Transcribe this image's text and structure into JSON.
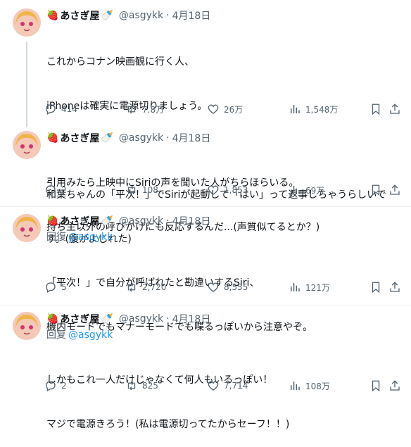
{
  "colors": {
    "text": "#0f1419",
    "muted": "#536471",
    "link": "#1d9bf0",
    "divider": "#eff3f4",
    "thread_line": "#cfd9de"
  },
  "tweets": [
    {
      "name": "あさぎ屋",
      "handle": "@asgykk",
      "separator": "·",
      "date": "4月18日",
      "reply_to_label": "",
      "reply_to_handle": "",
      "lines": [
        "これからコナン映画観に行く人、",
        "iPhoneは確実に電源切りましょう。",
        "",
        "和葉ちゃんの「平次！」でSiriが起動して「はい」って返事しちゃうらしいで",
        "す。(腹がよじれた)"
      ],
      "stats": {
        "replies": "414",
        "retweets": "7.8万",
        "likes": "26万",
        "views": "1,548万"
      }
    },
    {
      "name": "あさぎ屋",
      "handle": "@asgykk",
      "separator": "·",
      "date": "4月18日",
      "reply_to_label": "",
      "reply_to_handle": "",
      "lines": [
        "引用みたら上映中にSiriの声を聞いた人がちらほらいる。",
        "持ち主以外の呼びかけにも反応するんだ...(声質似てるとか？)"
      ],
      "stats": {
        "replies": "2",
        "retweets": "108",
        "likes": "1,853",
        "views": "69万"
      }
    },
    {
      "name": "あさぎ屋",
      "handle": "@asgykk",
      "separator": "·",
      "date": "4月18日",
      "reply_to_label": "回復",
      "reply_to_handle": "@asgykk",
      "lines": [
        "「平次！」で自分が呼ばれたと勘違いするSiri、",
        "機内モードでもマナーモードでも喋るっぽいから注意やぞ。"
      ],
      "stats": {
        "replies": "5",
        "retweets": "2,720",
        "likes": "8,555",
        "views": "121万"
      }
    },
    {
      "name": "あさぎ屋",
      "handle": "@asgykk",
      "separator": "·",
      "date": "4月18日",
      "reply_to_label": "回复",
      "reply_to_handle": "@asgykk",
      "lines": [
        "しかもこれ一人だけじゃなくて何人もいるっぽい！",
        "マジで電源きろう！(私は電源切ってたからセーフ！！)"
      ],
      "stats": {
        "replies": "2",
        "retweets": "825",
        "likes": "7,714",
        "views": "108万"
      }
    }
  ]
}
